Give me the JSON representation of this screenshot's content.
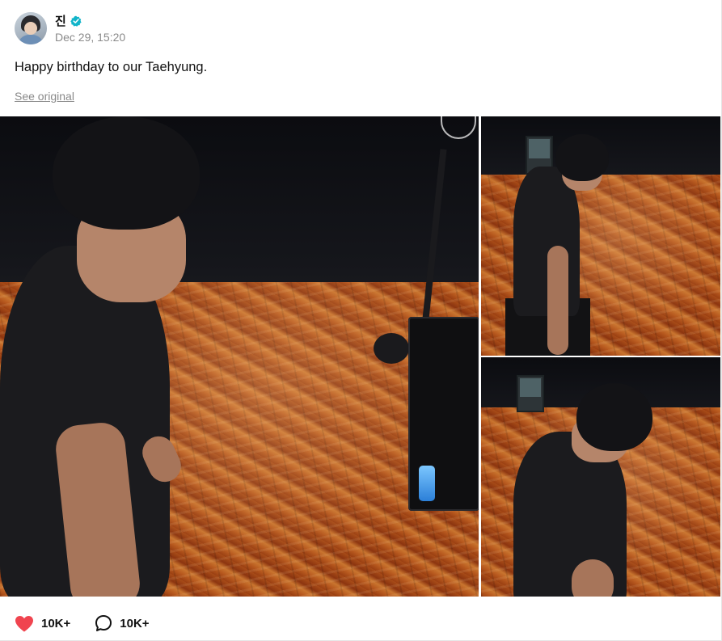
{
  "post": {
    "author": {
      "name": "진",
      "verified": true,
      "avatar_icon": "avatar-photo"
    },
    "timestamp": "Dec 29, 15:20",
    "text": "Happy birthday to our Taehyung.",
    "see_original_label": "See original"
  },
  "media": {
    "photos": [
      {
        "name": "photo-main",
        "icon": "photo"
      },
      {
        "name": "photo-top-right",
        "icon": "photo"
      },
      {
        "name": "photo-bottom-right",
        "icon": "photo"
      }
    ]
  },
  "actions": {
    "like": {
      "icon": "heart-icon",
      "count": "10K+",
      "color": "#f0444f"
    },
    "comment": {
      "icon": "comment-bubble-icon",
      "count": "10K+"
    }
  },
  "colors": {
    "verified_badge": "#11b4c9",
    "timestamp": "#8a8a8a",
    "like": "#f0444f"
  }
}
